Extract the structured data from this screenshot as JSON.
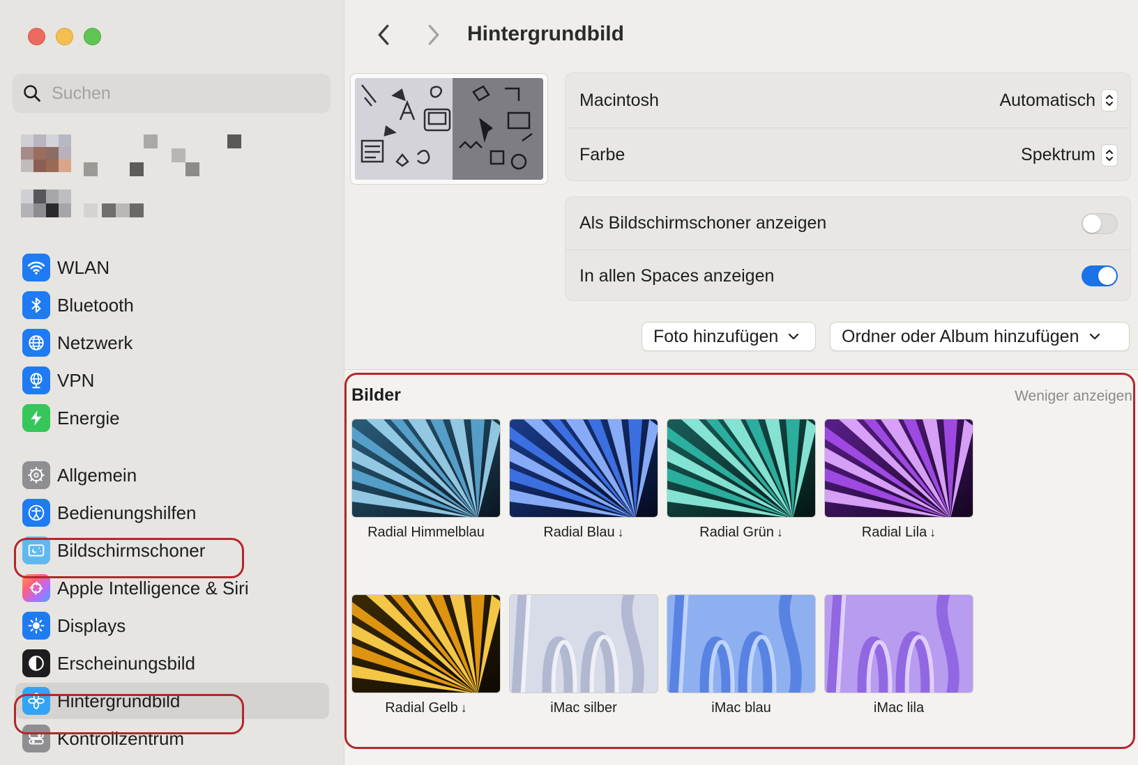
{
  "sidebar": {
    "search_placeholder": "Suchen",
    "items": [
      {
        "label": "WLAN",
        "icon": "wifi-icon",
        "color": "#1e7bf2"
      },
      {
        "label": "Bluetooth",
        "icon": "bluetooth-icon",
        "color": "#1e7bf2"
      },
      {
        "label": "Netzwerk",
        "icon": "globe-icon",
        "color": "#1e7bf2"
      },
      {
        "label": "VPN",
        "icon": "vpn-globe-icon",
        "color": "#1e7bf2"
      },
      {
        "label": "Energie",
        "icon": "lightning-icon",
        "color": "#35c759"
      },
      {
        "label": "Allgemein",
        "icon": "gear-icon",
        "color": "#8e8e93"
      },
      {
        "label": "Bedienungshilfen",
        "icon": "accessibility-icon",
        "color": "#1e7bf2"
      },
      {
        "label": "Bildschirmschoner",
        "icon": "screensaver-icon",
        "color": "#5fb8f0"
      },
      {
        "label": "Apple Intelligence & Siri",
        "icon": "siri-icon",
        "color": "#ff6b6b"
      },
      {
        "label": "Displays",
        "icon": "sun-icon",
        "color": "#1e7bf2"
      },
      {
        "label": "Erscheinungsbild",
        "icon": "appearance-icon",
        "color": "#1d1d1f"
      },
      {
        "label": "Hintergrundbild",
        "icon": "flower-icon",
        "color": "#33a3f5"
      },
      {
        "label": "Kontrollzentrum",
        "icon": "control-center-icon",
        "color": "#8e8e93"
      }
    ]
  },
  "header": {
    "title": "Hintergrundbild"
  },
  "settings": {
    "macintosh_label": "Macintosh",
    "macintosh_value": "Automatisch",
    "farbe_label": "Farbe",
    "farbe_value": "Spektrum",
    "screensaver_label": "Als Bildschirmschoner anzeigen",
    "screensaver_on": false,
    "spaces_label": "In allen Spaces anzeigen",
    "spaces_on": true
  },
  "buttons": {
    "add_photo": "Foto hinzufügen",
    "add_folder": "Ordner oder Album hinzufügen"
  },
  "gallery": {
    "title": "Bilder",
    "less_link": "Weniger anzeigen",
    "items": [
      {
        "label": "Radial Himmelblau",
        "download": false
      },
      {
        "label": "Radial Blau",
        "download": true
      },
      {
        "label": "Radial Grün",
        "download": true
      },
      {
        "label": "Radial Lila",
        "download": true
      },
      {
        "label": "Radial Gelb",
        "download": true
      },
      {
        "label": "iMac silber",
        "download": false
      },
      {
        "label": "iMac blau",
        "download": false
      },
      {
        "label": "iMac lila",
        "download": false
      }
    ],
    "download_glyph": "↓"
  },
  "colors": {
    "accent": "#1a73e8",
    "highlight_ring": "#b3272a"
  }
}
